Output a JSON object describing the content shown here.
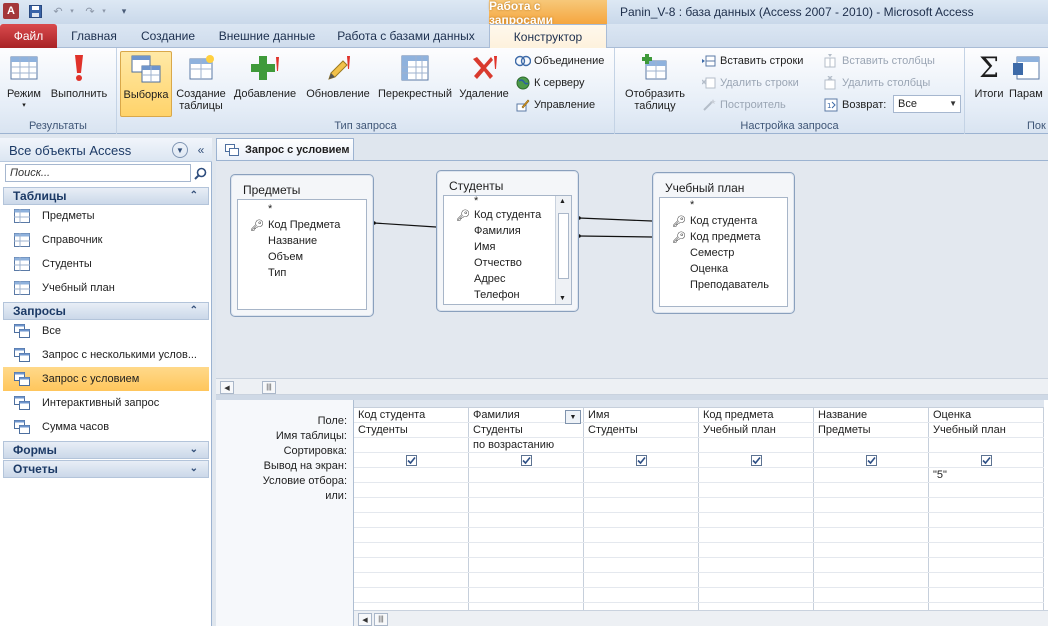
{
  "title_bar": {
    "context_tab_title": "Работа с запросами",
    "window_title": "Panin_V-8 : база данных (Access 2007 - 2010)  -  Microsoft Access"
  },
  "tabs": [
    {
      "label": "Файл"
    },
    {
      "label": "Главная"
    },
    {
      "label": "Создание"
    },
    {
      "label": "Внешние данные"
    },
    {
      "label": "Работа с базами данных"
    },
    {
      "label": "Конструктор"
    }
  ],
  "ribbon": {
    "results_group": {
      "label": "Результаты",
      "mode": "Режим",
      "run": "Выполнить"
    },
    "query_type_group": {
      "label": "Тип запроса",
      "select": "Выборка",
      "make_table_1": "Создание",
      "make_table_2": "таблицы",
      "append": "Добавление",
      "update": "Обновление",
      "crosstab": "Перекрестный",
      "delete": "Удаление",
      "union": "Объединение",
      "to_server": "К серверу",
      "manage": "Управление"
    },
    "setup_group": {
      "label": "Настройка запроса",
      "show_table_1": "Отобразить",
      "show_table_2": "таблицу",
      "insert_rows": "Вставить строки",
      "delete_rows": "Удалить строки",
      "builder": "Построитель",
      "insert_cols": "Вставить столбцы",
      "delete_cols": "Удалить столбцы",
      "return_label": "Возврат:",
      "return_value": "Все"
    },
    "totals": "Итоги",
    "params": "Парам",
    "next_group_label": "Пок"
  },
  "nav": {
    "title": "Все объекты Access",
    "search_placeholder": "Поиск...",
    "sections": {
      "tables": {
        "label": "Таблицы",
        "items": [
          "Предметы",
          "Справочник",
          "Студенты",
          "Учебный план"
        ]
      },
      "queries": {
        "label": "Запросы",
        "items": [
          "Все",
          "Запрос с несколькими услов...",
          "Запрос с условием",
          "Интерактивный запрос",
          "Сумма часов"
        ]
      },
      "forms": {
        "label": "Формы"
      },
      "reports": {
        "label": "Отчеты"
      }
    }
  },
  "document": {
    "tab_label": "Запрос с условием",
    "tables": [
      {
        "title": "Предметы",
        "fields": [
          "*",
          "Код Предмета",
          "Название",
          "Объем",
          "Тип"
        ]
      },
      {
        "title": "Студенты",
        "fields": [
          "*",
          "Код студента",
          "Фамилия",
          "Имя",
          "Отчество",
          "Адрес",
          "Телефон"
        ]
      },
      {
        "title": "Учебный план",
        "fields": [
          "*",
          "Код студента",
          "Код предмета",
          "Семестр",
          "Оценка",
          "Преподаватель"
        ]
      }
    ],
    "grid": {
      "row_labels": [
        "Поле:",
        "Имя таблицы:",
        "Сортировка:",
        "Вывод на экран:",
        "Условие отбора:",
        "или:"
      ],
      "columns": [
        {
          "field": "Код студента",
          "table": "Студенты",
          "sort": "",
          "show": true,
          "criteria": ""
        },
        {
          "field": "Фамилия",
          "table": "Студенты",
          "sort": "по возрастанию",
          "show": true,
          "criteria": ""
        },
        {
          "field": "Имя",
          "table": "Студенты",
          "sort": "",
          "show": true,
          "criteria": ""
        },
        {
          "field": "Код предмета",
          "table": "Учебный план",
          "sort": "",
          "show": true,
          "criteria": ""
        },
        {
          "field": "Название",
          "table": "Предметы",
          "sort": "",
          "show": true,
          "criteria": ""
        },
        {
          "field": "Оценка",
          "table": "Учебный план",
          "sort": "",
          "show": true,
          "criteria": "\"5\""
        }
      ]
    }
  },
  "colors": {
    "file_tab": "#b7292c",
    "context_tab": "#f5a33a",
    "selection": "#ffc65c",
    "accent": "#1c3a66"
  }
}
